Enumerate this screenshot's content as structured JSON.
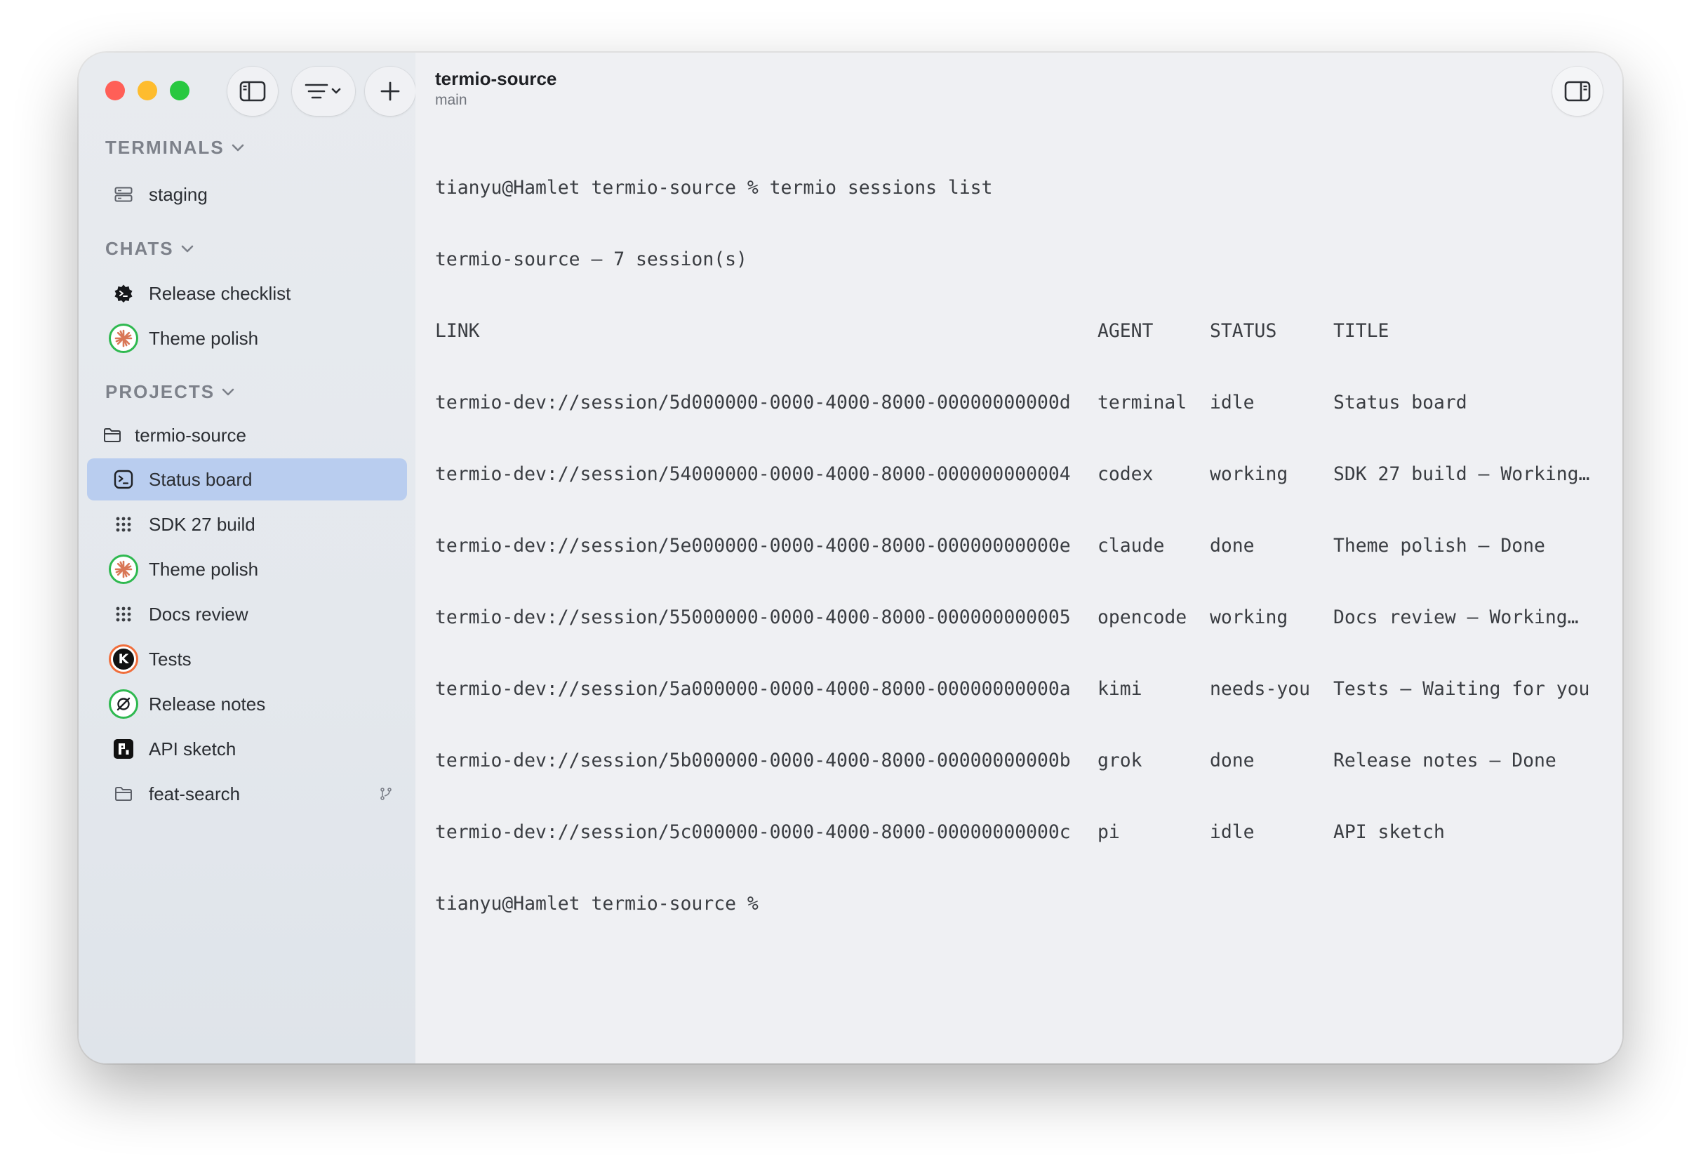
{
  "window": {
    "controls": [
      "close",
      "minimize",
      "zoom"
    ]
  },
  "toolbar": {
    "buttons": [
      "sidebar-toggle-icon",
      "filter-icon",
      "plus-icon"
    ]
  },
  "sidebar": {
    "terminals": {
      "header": "TERMINALS",
      "items": [
        {
          "label": "staging",
          "icon": "server-icon"
        }
      ]
    },
    "chats": {
      "header": "CHATS",
      "items": [
        {
          "label": "Release checklist",
          "icon": "gear-badge-icon"
        },
        {
          "label": "Theme polish",
          "icon": "claude-sparkle-icon"
        }
      ]
    },
    "projects": {
      "header": "PROJECTS",
      "root": {
        "label": "termio-source",
        "icon": "folder-icon"
      },
      "items": [
        {
          "label": "Status board",
          "icon": "terminal-icon",
          "selected": true
        },
        {
          "label": "SDK 27 build",
          "icon": "dots-grid-icon"
        },
        {
          "label": "Theme polish",
          "icon": "claude-sparkle-icon"
        },
        {
          "label": "Docs review",
          "icon": "dots-grid-icon"
        },
        {
          "label": "Tests",
          "icon": "kimi-k-icon"
        },
        {
          "label": "Release notes",
          "icon": "grok-icon"
        },
        {
          "label": "API sketch",
          "icon": "pi-icon"
        },
        {
          "label": "feat-search",
          "icon": "folder-icon",
          "trailing_icon": "git-branch-icon"
        }
      ]
    }
  },
  "header": {
    "title": "termio-source",
    "subtitle": "main"
  },
  "terminal": {
    "prompt_line": "tianyu@Hamlet termio-source % termio sessions list",
    "summary_line": "termio-source — 7 session(s)",
    "columns": [
      "LINK",
      "AGENT",
      "STATUS",
      "TITLE"
    ],
    "rows": [
      {
        "link": "termio-dev://session/5d000000-0000-4000-8000-00000000000d",
        "agent": "terminal",
        "status": "idle",
        "title": "Status board"
      },
      {
        "link": "termio-dev://session/54000000-0000-4000-8000-000000000004",
        "agent": "codex",
        "status": "working",
        "title": "SDK 27 build — Working…"
      },
      {
        "link": "termio-dev://session/5e000000-0000-4000-8000-00000000000e",
        "agent": "claude",
        "status": "done",
        "title": "Theme polish — Done"
      },
      {
        "link": "termio-dev://session/55000000-0000-4000-8000-000000000005",
        "agent": "opencode",
        "status": "working",
        "title": "Docs review — Working…"
      },
      {
        "link": "termio-dev://session/5a000000-0000-4000-8000-00000000000a",
        "agent": "kimi",
        "status": "needs-you",
        "title": "Tests — Waiting for you"
      },
      {
        "link": "termio-dev://session/5b000000-0000-4000-8000-00000000000b",
        "agent": "grok",
        "status": "done",
        "title": "Release notes — Done"
      },
      {
        "link": "termio-dev://session/5c000000-0000-4000-8000-00000000000c",
        "agent": "pi",
        "status": "idle",
        "title": "API sketch"
      }
    ],
    "final_prompt": "tianyu@Hamlet termio-source %"
  },
  "colors": {
    "selection": "#b9cdef",
    "ring_green": "#2fb950",
    "ring_orange": "#f06e3c",
    "close": "#ff5f57",
    "minimize": "#febc2e",
    "zoom": "#28c840"
  }
}
